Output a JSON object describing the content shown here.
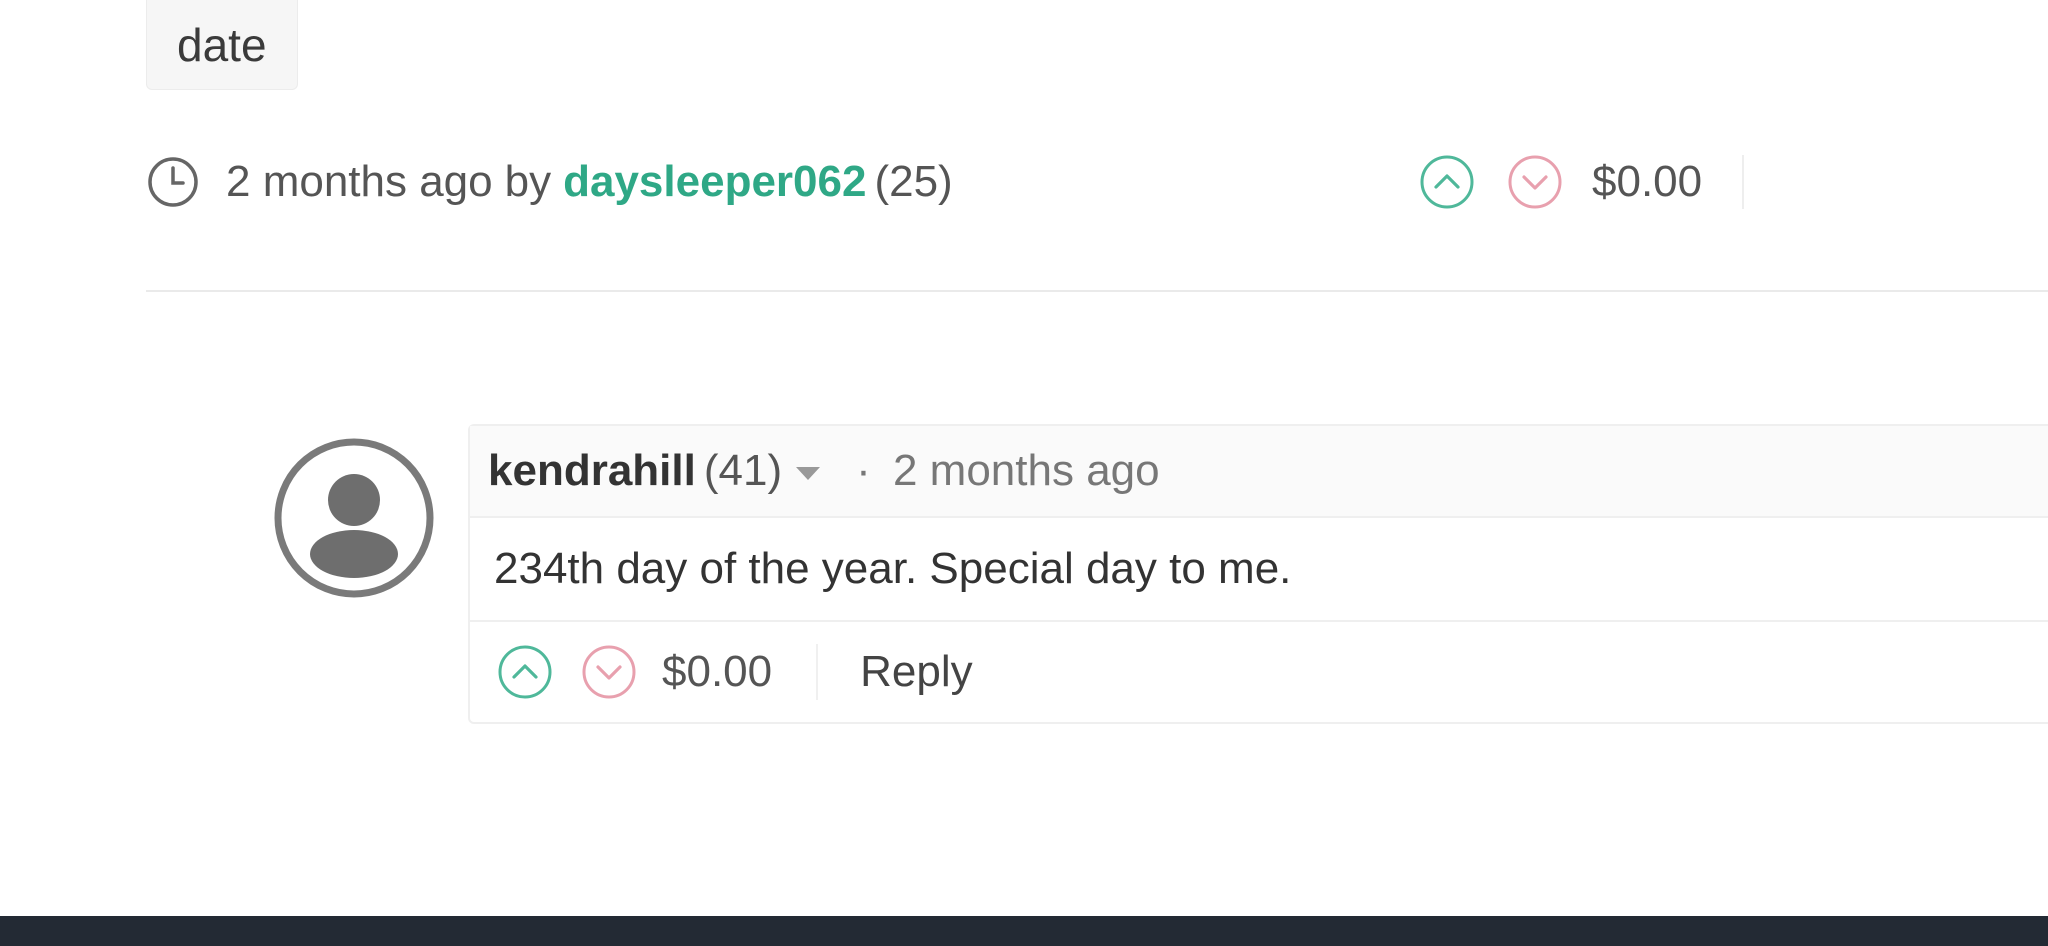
{
  "tag": {
    "label": "date"
  },
  "post": {
    "time_ago": "2 months ago",
    "by_label": "by",
    "author": "daysleeper062",
    "reputation": "(25)",
    "payout": "$0.00"
  },
  "comment": {
    "author": "kendrahill",
    "reputation": "(41)",
    "separator": "·",
    "time_ago": "2 months ago",
    "body": "234th day of the year. Special day to me.",
    "payout": "$0.00",
    "reply_label": "Reply"
  },
  "icons": {
    "clock": "clock-icon",
    "upvote": "chevron-up-circle-icon",
    "downvote": "chevron-down-circle-icon",
    "avatar": "user-silhouette-icon",
    "caret": "caret-down-icon"
  },
  "colors": {
    "author_link": "#2fa886",
    "upvote": "#4fb89a",
    "downvote": "#e8a0ae",
    "bottom_bar": "#232a34"
  }
}
